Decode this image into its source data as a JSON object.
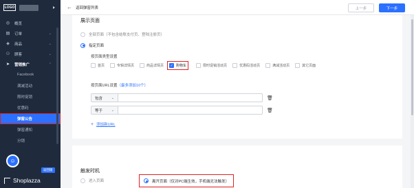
{
  "sidebar": {
    "logo_text": "LOGO",
    "nav": [
      {
        "label": "概览",
        "icon": "dashboard-icon",
        "chevron": false
      },
      {
        "label": "订单",
        "icon": "order-icon",
        "chevron": true
      },
      {
        "label": "商品",
        "icon": "product-icon",
        "chevron": true
      },
      {
        "label": "顾客",
        "icon": "customer-icon",
        "chevron": true
      },
      {
        "label": "营销推广",
        "icon": "marketing-icon",
        "chevron": true
      }
    ],
    "sub_items": [
      "Facebook",
      "满减活动",
      "限时促销",
      "优惠码",
      "弹窗公告",
      "弹窗通知",
      "分销"
    ],
    "brand": "Shoplazza",
    "chat_tag": "返回版"
  },
  "topbar": {
    "back_label": "返回弹窗列表",
    "prev_label": "上一步",
    "next_label": "下一步"
  },
  "display": {
    "title": "展示页面",
    "option_all": "全部页面（不包含结账支付页、登陆注册页）",
    "option_specific": "指定页面",
    "type_label": "按页面类型设置",
    "page_types": [
      {
        "label": "首页",
        "checked": false
      },
      {
        "label": "专辑详情页",
        "checked": false
      },
      {
        "label": "商品详情页",
        "checked": false
      },
      {
        "label": "购物车",
        "checked": true
      },
      {
        "label": "限时促销活动页",
        "checked": false
      },
      {
        "label": "优惠码活动页",
        "checked": false
      },
      {
        "label": "满减活动页",
        "checked": false
      },
      {
        "label": "其它页面",
        "checked": false
      }
    ],
    "url_label": "按页面URL设置",
    "url_hint": "（最多添加10个）",
    "url_rules": [
      {
        "match": "包含",
        "value": ""
      },
      {
        "match": "等于",
        "value": ""
      }
    ],
    "add_url": "添加新URL"
  },
  "trigger": {
    "title": "触发时机",
    "option_enter": "进入页面",
    "option_leave": "离开页面（仅对PC端生效，手机端无法触发）"
  }
}
